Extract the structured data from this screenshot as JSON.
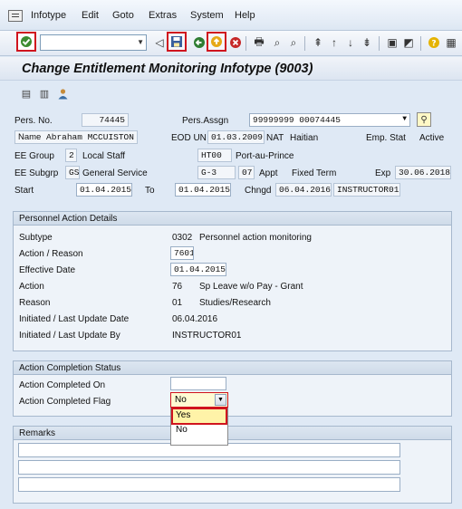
{
  "menu": [
    "Infotype",
    "Edit",
    "Goto",
    "Extras",
    "System",
    "Help"
  ],
  "title": "Change Entitlement Monitoring Infotype (9003)",
  "header": {
    "pers_no_label": "Pers. No.",
    "pers_no": "74445",
    "pers_assgn_label": "Pers.Assgn",
    "pers_assgn": "99999999 00074445",
    "name_label": "Name",
    "name": "Abraham MCCUISTON",
    "eod_label": "EOD UN",
    "eod": "01.03.2009",
    "nat_label": "NAT",
    "nat": "Haitian",
    "emp_stat_label": "Emp. Stat",
    "emp_stat": "Active",
    "ee_group_label": "EE Group",
    "ee_group": "2",
    "ee_group_text": "Local Staff",
    "loc_code": "HT00",
    "loc_text": "Port-au-Prince",
    "ee_subgrp_label": "EE Subgrp",
    "ee_subgrp": "GS",
    "ee_subgrp_text": "General Service",
    "grade": "G-3",
    "step": "07",
    "appt_label": "Appt",
    "appt": "Fixed Term",
    "exp_label": "Exp",
    "exp": "30.06.2018",
    "start_label": "Start",
    "start": "01.04.2015",
    "to_label": "To",
    "to": "01.04.2015",
    "chngd_label": "Chngd",
    "chngd": "06.04.2016",
    "chngd_by": "INSTRUCTOR01"
  },
  "pad": {
    "heading": "Personnel Action Details",
    "subtype_label": "Subtype",
    "subtype": "0302",
    "subtype_text": "Personnel action monitoring",
    "action_reason_label": "Action / Reason",
    "action_reason": "7601",
    "effective_label": "Effective Date",
    "effective": "01.04.2015",
    "action_label": "Action",
    "action": "76",
    "action_text": "Sp Leave w/o Pay - Grant",
    "reason_label": "Reason",
    "reason": "01",
    "reason_text": "Studies/Research",
    "init_date_label": "Initiated / Last Update Date",
    "init_date": "06.04.2016",
    "init_by_label": "Initiated / Last Update By",
    "init_by": "INSTRUCTOR01"
  },
  "acs": {
    "heading": "Action Completion Status",
    "completed_on_label": "Action Completed On",
    "completed_on": "",
    "flag_label": "Action Completed Flag",
    "flag": "No",
    "options": [
      "Yes",
      "No"
    ]
  },
  "remarks": {
    "heading": "Remarks"
  }
}
